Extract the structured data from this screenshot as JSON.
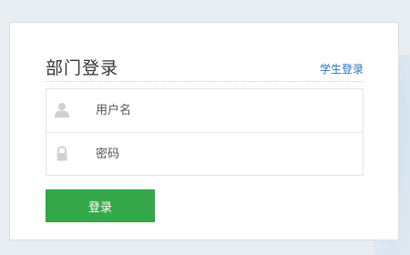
{
  "login_panel": {
    "title": "部门登录",
    "switch_link": "学生登录",
    "username_placeholder": "用户名",
    "password_placeholder": "密码",
    "submit_label": "登录"
  },
  "icons": {
    "username": "user-icon",
    "password": "lock-icon"
  },
  "colors": {
    "accent_green": "#36a84a",
    "link_blue": "#2c72b8",
    "background": "#e9eef3"
  }
}
